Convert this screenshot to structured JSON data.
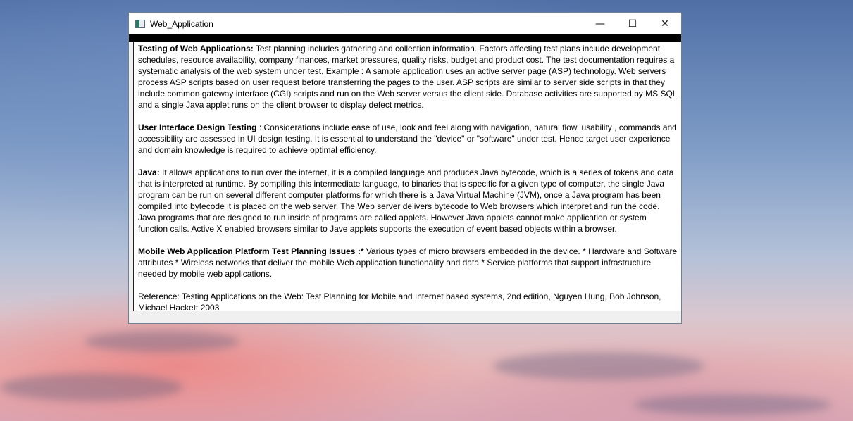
{
  "window": {
    "title": "Web_Application",
    "controls": {
      "minimize": "—",
      "maximize": "☐",
      "close": "✕"
    }
  },
  "content": {
    "sections": [
      {
        "heading": "Testing of Web Applications:",
        "body": "  Test planning includes gathering and collection information.  Factors affecting test plans include development schedules, resource availability, company finances, market pressures, quality risks, budget and product cost. The test documentation requires a systematic analysis of the web system under test.   Example : A sample application uses an active server page (ASP) technology. Web servers process ASP scripts based on user request before transferring the pages to the  user.  ASP scripts are similar to server side scripts in that they include common gateway interface (CGI) scripts and run on the Web server versus the client side. Database activities are supported by MS SQL and a single Java applet runs on the client browser to display defect metrics."
      },
      {
        "heading": "User Interface Design Testing",
        "body": " : Considerations include ease of use, look and feel along with navigation, natural flow, usability , commands and accessibility are assessed in UI design testing.  It is essential to understand the \"device\" or \"software\" under test.  Hence target user experience and domain knowledge is required to achieve optimal efficiency."
      },
      {
        "heading": "Java:",
        "body": "  It allows applications to run over the internet, it is a compiled language and produces Java bytecode, which is  a series of tokens and data that is interpreted at runtime.  By compiling this intermediate language, to binaries that is specific for a given type of computer, the single Java program can be run on several different computer platforms for which there is a Java Virtual Machine (JVM), once a Java program has been compiled into bytecode it is placed on the web server. The Web server delivers bytecode to Web browsers which interpret and run the code. Java programs that are designed to run inside of programs are called applets.  However Java applets cannot make application or system function calls. Active X enabled browsers similar to Jave applets supports the execution of event based objects within a browser."
      },
      {
        "heading": "Mobile Web Application Platform Test Planning Issues :*",
        "body": "  Various types of micro browsers embedded in the device. *  Hardware and Software attributes * Wireless networks that deliver the mobile Web application functionality and data * Service platforms that support infrastructure needed by mobile web applications."
      }
    ],
    "reference": "Reference: Testing Applications on the Web: Test Planning for Mobile and Internet based systems, 2nd edition, Nguyen Hung, Bob Johnson, Michael Hackett 2003"
  }
}
